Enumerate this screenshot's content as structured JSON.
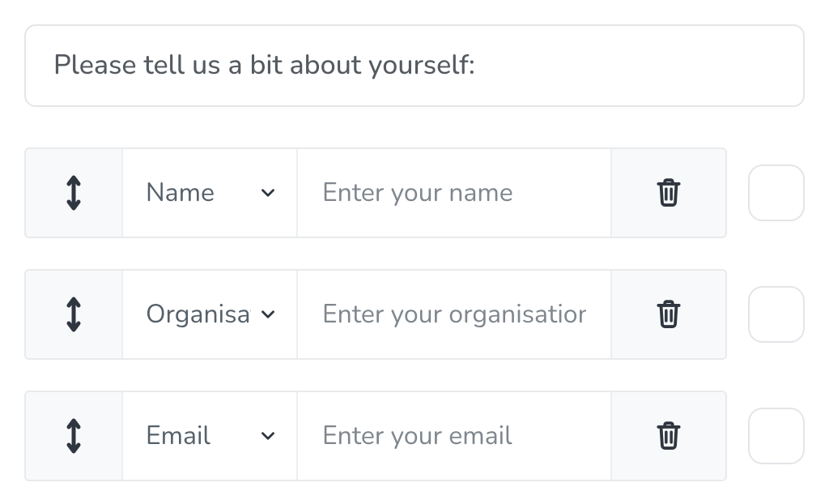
{
  "header": {
    "prompt": "Please tell us a bit about yourself:"
  },
  "rows": [
    {
      "type_label": "Name",
      "placeholder": "Enter your name"
    },
    {
      "type_label": "Organisation",
      "placeholder": "Enter your organisation"
    },
    {
      "type_label": "Email",
      "placeholder": "Enter your email"
    }
  ],
  "icons": {
    "drag": "drag-vertical-icon",
    "chevron": "chevron-down-icon",
    "trash": "trash-icon"
  }
}
